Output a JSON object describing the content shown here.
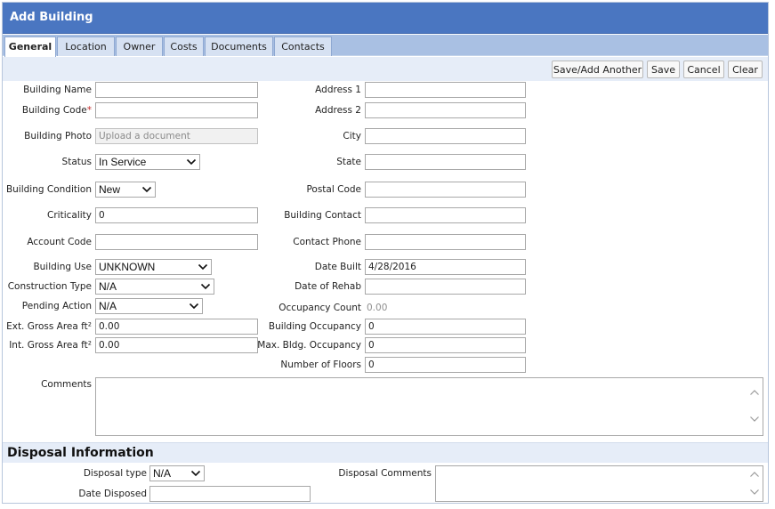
{
  "title": "Add Building",
  "tabs": [
    "General",
    "Location",
    "Owner",
    "Costs",
    "Documents",
    "Contacts"
  ],
  "toolbar": {
    "save_add_another": "Save/Add Another",
    "save": "Save",
    "cancel": "Cancel",
    "clear": "Clear"
  },
  "left": {
    "building_name": {
      "label": "Building Name",
      "value": ""
    },
    "building_code": {
      "label": "Building Code",
      "required_mark": "*",
      "value": ""
    },
    "building_photo": {
      "label": "Building Photo",
      "placeholder": "Upload a document"
    },
    "status": {
      "label": "Status",
      "value": "In Service"
    },
    "building_condition": {
      "label": "Building Condition",
      "value": "New"
    },
    "criticality": {
      "label": "Criticality",
      "value": "0"
    },
    "account_code": {
      "label": "Account Code",
      "value": ""
    },
    "building_use": {
      "label": "Building Use",
      "value": "UNKNOWN"
    },
    "construction_type": {
      "label": "Construction Type",
      "value": "N/A"
    },
    "pending_action": {
      "label": "Pending Action",
      "value": "N/A"
    },
    "ext_gross_area": {
      "label": "Ext. Gross Area ft²",
      "value": "0.00"
    },
    "int_gross_area": {
      "label": "Int. Gross Area ft²",
      "value": "0.00"
    },
    "comments": {
      "label": "Comments",
      "value": ""
    }
  },
  "right": {
    "address1": {
      "label": "Address 1",
      "value": ""
    },
    "address2": {
      "label": "Address 2",
      "value": ""
    },
    "city": {
      "label": "City",
      "value": ""
    },
    "state": {
      "label": "State",
      "value": ""
    },
    "postal_code": {
      "label": "Postal Code",
      "value": ""
    },
    "building_contact": {
      "label": "Building Contact",
      "value": ""
    },
    "contact_phone": {
      "label": "Contact Phone",
      "value": ""
    },
    "date_built": {
      "label": "Date Built",
      "value": "4/28/2016"
    },
    "date_of_rehab": {
      "label": "Date of Rehab",
      "value": ""
    },
    "occupancy_count": {
      "label": "Occupancy Count",
      "value": "0.00"
    },
    "building_occupancy": {
      "label": "Building Occupancy",
      "value": "0"
    },
    "max_bldg_occupancy": {
      "label": "Max. Bldg. Occupancy",
      "value": "0"
    },
    "number_of_floors": {
      "label": "Number of Floors",
      "value": "0"
    }
  },
  "disposal": {
    "heading": "Disposal Information",
    "type": {
      "label": "Disposal type",
      "value": "N/A"
    },
    "date": {
      "label": "Date Disposed",
      "value": ""
    },
    "comments": {
      "label": "Disposal Comments",
      "value": ""
    }
  },
  "colors": {
    "title_bar": "#4a76c1",
    "tab_strip": "#a9c0e3",
    "toolbar": "#e6edf8",
    "required": "#c32b2b"
  },
  "icons": {
    "dropdown": "chevron-down-icon",
    "scroll_up": "scroll-up-arrow-icon",
    "scroll_down": "scroll-down-arrow-icon"
  }
}
